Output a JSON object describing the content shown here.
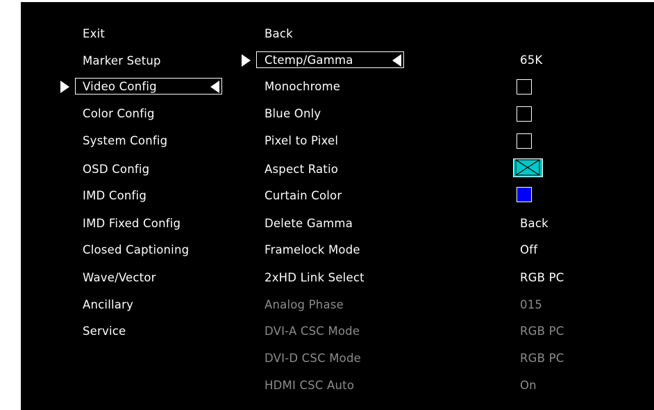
{
  "colors": {
    "background": "#000000",
    "text": "#ffffff",
    "disabled_text": "#8c8c8c",
    "aspect_swatch": "#00c8c8",
    "curtain_swatch": "#0000ff"
  },
  "left_menu": [
    {
      "label": "Exit"
    },
    {
      "label": "Marker Setup"
    },
    {
      "label": "Video Config",
      "selected": true
    },
    {
      "label": "Color Config"
    },
    {
      "label": "System Config"
    },
    {
      "label": "OSD Config"
    },
    {
      "label": "IMD Config"
    },
    {
      "label": "IMD Fixed Config"
    },
    {
      "label": "Closed Captioning"
    },
    {
      "label": "Wave/Vector"
    },
    {
      "label": "Ancillary"
    },
    {
      "label": "Service"
    }
  ],
  "mid_menu": [
    {
      "label": "Back"
    },
    {
      "label": "Ctemp/Gamma",
      "selected": true
    },
    {
      "label": "Monochrome"
    },
    {
      "label": "Blue Only"
    },
    {
      "label": "Pixel to Pixel"
    },
    {
      "label": "Aspect Ratio"
    },
    {
      "label": "Curtain Color"
    },
    {
      "label": "Delete Gamma"
    },
    {
      "label": "Framelock Mode"
    },
    {
      "label": "2xHD Link Select"
    },
    {
      "label": "Analog Phase",
      "disabled": true
    },
    {
      "label": "DVI-A CSC Mode",
      "disabled": true
    },
    {
      "label": "DVI-D CSC Mode",
      "disabled": true
    },
    {
      "label": "HDMI CSC Auto",
      "disabled": true
    }
  ],
  "values": {
    "ctemp_gamma": "65K",
    "monochrome": "unchecked",
    "blue_only": "unchecked",
    "pixel_to_pixel": "unchecked",
    "aspect_ratio": "aspect-swatch",
    "curtain_color": "blue-swatch",
    "delete_gamma": "Back",
    "framelock_mode": "Off",
    "link_select": "RGB PC",
    "analog_phase": "015",
    "dvi_a_csc": "RGB PC",
    "dvi_d_csc": "RGB PC",
    "hdmi_csc_auto": "On"
  }
}
